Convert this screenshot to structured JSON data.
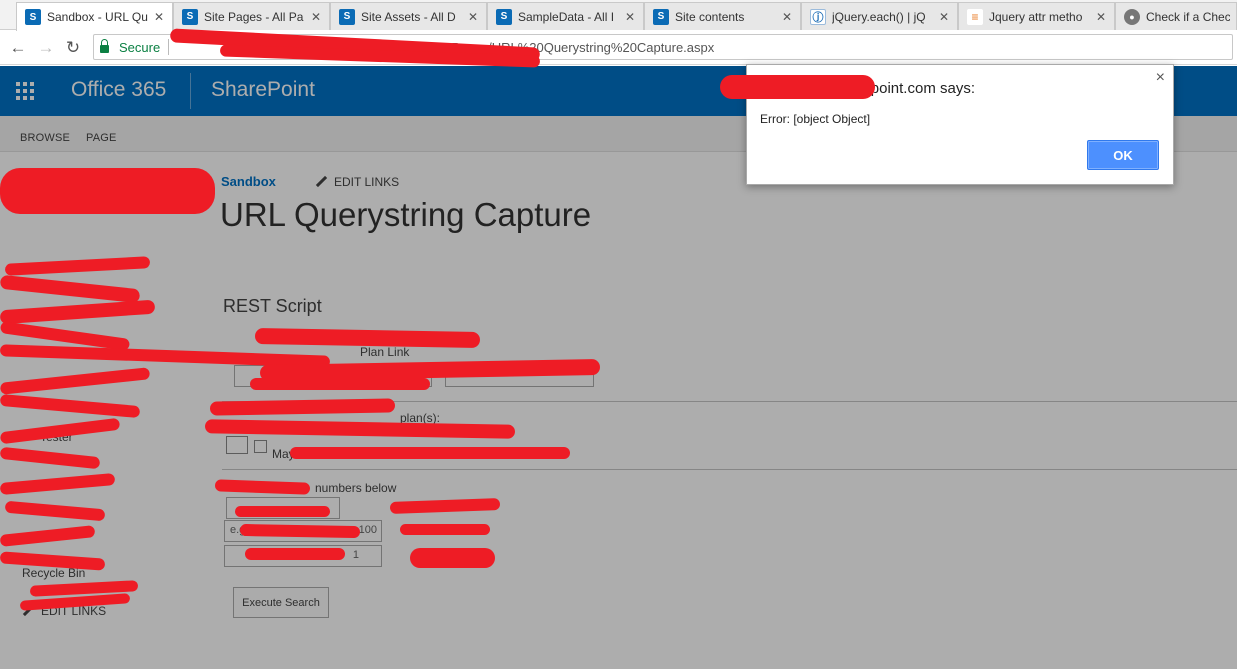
{
  "browser": {
    "tabs": [
      {
        "title": "Sandbox - URL Qu",
        "icon": "sharepoint-icon",
        "active": true
      },
      {
        "title": "Site Pages - All Pa",
        "icon": "sharepoint-icon",
        "active": false
      },
      {
        "title": "Site Assets - All D",
        "icon": "sharepoint-icon",
        "active": false
      },
      {
        "title": "SampleData - All I",
        "icon": "sharepoint-icon",
        "active": false
      },
      {
        "title": "Site contents",
        "icon": "sharepoint-icon",
        "active": false
      },
      {
        "title": "jQuery.each() | jQ",
        "icon": "jquery-icon",
        "active": false
      },
      {
        "title": "Jquery attr metho",
        "icon": "stackoverflow-icon",
        "active": false
      },
      {
        "title": "Check if a Checkb",
        "icon": "github-icon",
        "active": false
      }
    ],
    "secure_label": "Secure",
    "url_visible": "/SitePages/URL%20Querystring%20Capture.aspx"
  },
  "suitebar": {
    "product": "Office 365",
    "app": "SharePoint",
    "color": "#0072c6"
  },
  "ribbon": {
    "tabs": [
      "BROWSE",
      "PAGE"
    ]
  },
  "leftnav": {
    "items": [
      "Tester",
      "Recycle Bin"
    ],
    "edit_links": "EDIT LINKS"
  },
  "page": {
    "site_name": "Sandbox",
    "edit_links": "EDIT LINKS",
    "title": "URL Querystring Capture",
    "section": "REST Script",
    "link_label": "Plan Link",
    "plans_label": "plan(s):",
    "checkbox_text": "May aff",
    "numbers_label": "numbers below",
    "input_hint_1": "e.g",
    "input_value_1": "100",
    "input_value_2": "1",
    "execute_button": "Execute Search"
  },
  "dialog": {
    "title_suffix": "point.com says:",
    "message": "Error: [object Object]",
    "ok_label": "OK",
    "close_glyph": "×"
  }
}
